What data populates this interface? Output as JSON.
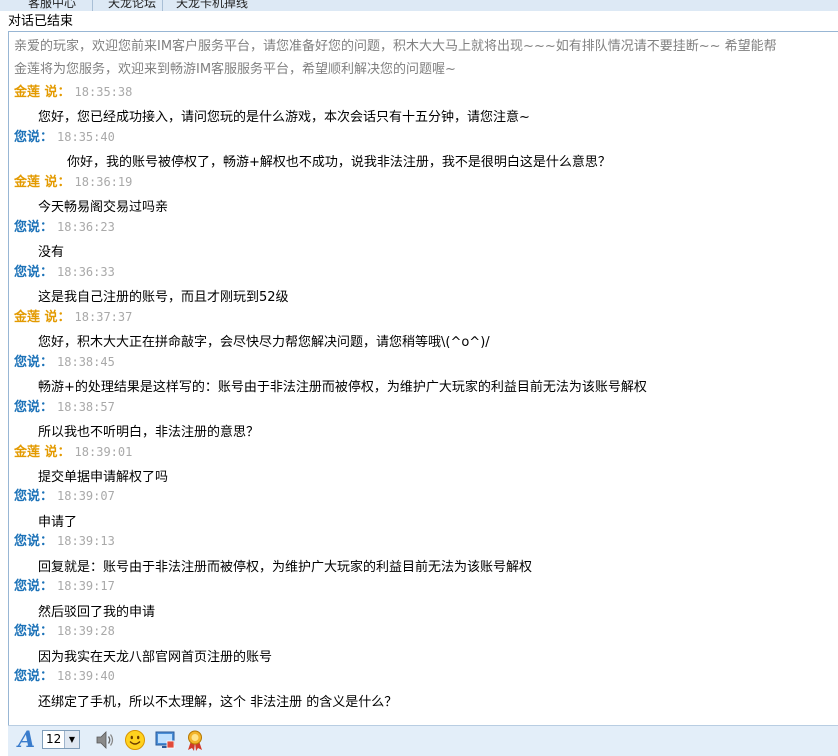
{
  "top_nav": {
    "tabs": [
      "客服中心",
      "天龙论坛",
      "天龙卡机掉线"
    ]
  },
  "status_text": "对话已结束",
  "system_messages": [
    "亲爱的玩家，欢迎您前来IM客户服务平台，请您准备好您的问题，积木大大马上就将出现~~~如有排队情况请不要挂断~~ 希望能帮",
    "金莲将为您服务，欢迎来到畅游IM客服服务平台，希望顺利解决您的问题喔~"
  ],
  "conversation": [
    {
      "sender": "金莲",
      "role": "agent",
      "colon": " 说：",
      "time": "18:35:38",
      "text": "您好，您已经成功接入，请问您玩的是什么游戏，本次会话只有十五分钟，请您注意~"
    },
    {
      "sender": "您说：",
      "role": "user",
      "colon": "",
      "time": "18:35:40",
      "text": "你好，我的账号被停权了，畅游+解权也不成功，说我非法注册，我不是很明白这是什么意思？"
    },
    {
      "sender": "金莲",
      "role": "agent",
      "colon": " 说：",
      "time": "18:36:19",
      "text": "今天畅易阁交易过吗亲"
    },
    {
      "sender": "您说：",
      "role": "user",
      "colon": "",
      "time": "18:36:23",
      "text": "没有"
    },
    {
      "sender": "您说：",
      "role": "user",
      "colon": "",
      "time": "18:36:33",
      "text": "这是我自己注册的账号，而且才刚玩到52级"
    },
    {
      "sender": "金莲",
      "role": "agent",
      "colon": " 说：",
      "time": "18:37:37",
      "text": "您好，积木大大正在拼命敲字，会尽快尽力帮您解决问题，请您稍等哦\\(^o^)/"
    },
    {
      "sender": "您说：",
      "role": "user",
      "colon": "",
      "time": "18:38:45",
      "text": "畅游+的处理结果是这样写的：账号由于非法注册而被停权，为维护广大玩家的利益目前无法为该账号解权"
    },
    {
      "sender": "您说：",
      "role": "user",
      "colon": "",
      "time": "18:38:57",
      "text": "所以我也不听明白，非法注册的意思？"
    },
    {
      "sender": "金莲",
      "role": "agent",
      "colon": " 说：",
      "time": "18:39:01",
      "text": "提交单据申请解权了吗"
    },
    {
      "sender": "您说：",
      "role": "user",
      "colon": "",
      "time": "18:39:07",
      "text": "申请了"
    },
    {
      "sender": "您说：",
      "role": "user",
      "colon": "",
      "time": "18:39:13",
      "text": "回复就是：账号由于非法注册而被停权，为维护广大玩家的利益目前无法为该账号解权"
    },
    {
      "sender": "您说：",
      "role": "user",
      "colon": "",
      "time": "18:39:17",
      "text": "然后驳回了我的申请"
    },
    {
      "sender": "您说：",
      "role": "user",
      "colon": "",
      "time": "18:39:28",
      "text": "因为我实在天龙八部官网首页注册的账号"
    },
    {
      "sender": "您说：",
      "role": "user",
      "colon": "",
      "time": "18:39:40",
      "text": "还绑定了手机，所以不太理解，这个 非法注册 的含义是什么？"
    }
  ],
  "toolbar": {
    "font_size_value": "12",
    "icons": [
      "font-style-icon",
      "speaker-icon",
      "emoji-icon",
      "screenshot-icon",
      "award-icon"
    ]
  },
  "colors": {
    "agent_name": "#e39a00",
    "user_name": "#1c72b8",
    "timestamp": "#a9a9a9",
    "system_text": "#808080",
    "toolbar_bg": "#e3eef9"
  }
}
